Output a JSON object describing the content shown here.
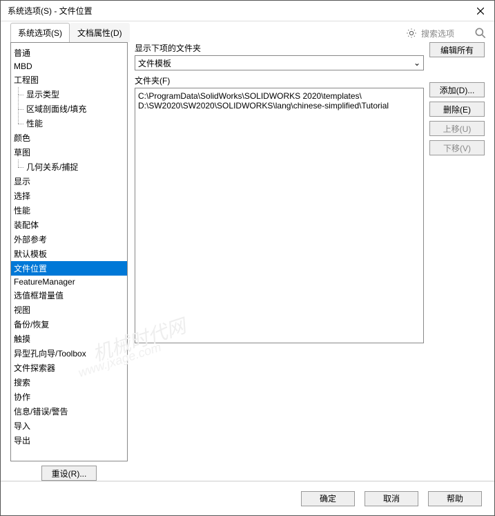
{
  "window": {
    "title": "系统选项(S) - 文件位置"
  },
  "tabs": {
    "system": "系统选项(S)",
    "doc": "文档属性(D)"
  },
  "search": {
    "placeholder": "搜索选项"
  },
  "tree": {
    "items": [
      {
        "label": "普通",
        "depth": 0
      },
      {
        "label": "MBD",
        "depth": 0
      },
      {
        "label": "工程图",
        "depth": 0
      },
      {
        "label": "显示类型",
        "depth": 1
      },
      {
        "label": "区域剖面线/填充",
        "depth": 1
      },
      {
        "label": "性能",
        "depth": 1
      },
      {
        "label": "颜色",
        "depth": 0
      },
      {
        "label": "草图",
        "depth": 0
      },
      {
        "label": "几何关系/捕捉",
        "depth": 1
      },
      {
        "label": "显示",
        "depth": 0
      },
      {
        "label": "选择",
        "depth": 0
      },
      {
        "label": "性能",
        "depth": 0
      },
      {
        "label": "装配体",
        "depth": 0
      },
      {
        "label": "外部参考",
        "depth": 0
      },
      {
        "label": "默认模板",
        "depth": 0
      },
      {
        "label": "文件位置",
        "depth": 0,
        "selected": true
      },
      {
        "label": "FeatureManager",
        "depth": 0
      },
      {
        "label": "选值框增量值",
        "depth": 0
      },
      {
        "label": "视图",
        "depth": 0
      },
      {
        "label": "备份/恢复",
        "depth": 0
      },
      {
        "label": "触摸",
        "depth": 0
      },
      {
        "label": "异型孔向导/Toolbox",
        "depth": 0
      },
      {
        "label": "文件探索器",
        "depth": 0
      },
      {
        "label": "搜索",
        "depth": 0
      },
      {
        "label": "协作",
        "depth": 0
      },
      {
        "label": "信息/错误/警告",
        "depth": 0
      },
      {
        "label": "导入",
        "depth": 0
      },
      {
        "label": "导出",
        "depth": 0
      }
    ],
    "reset": "重设(R)..."
  },
  "main": {
    "show_label": "显示下项的文件夹",
    "dropdown_value": "文件模板",
    "folder_label": "文件夹(F)",
    "folders": [
      "C:\\ProgramData\\SolidWorks\\SOLIDWORKS 2020\\templates\\",
      "D:\\SW2020\\SW2020\\SOLIDWORKS\\lang\\chinese-simplified\\Tutorial"
    ]
  },
  "buttons": {
    "edit_all": "编辑所有",
    "add": "添加(D)...",
    "delete": "删除(E)",
    "move_up": "上移(U)",
    "move_down": "下移(V)"
  },
  "footer": {
    "ok": "确定",
    "cancel": "取消",
    "help": "帮助"
  },
  "watermark": {
    "line1": "机械时代网",
    "line2": "www.jxage.com"
  }
}
